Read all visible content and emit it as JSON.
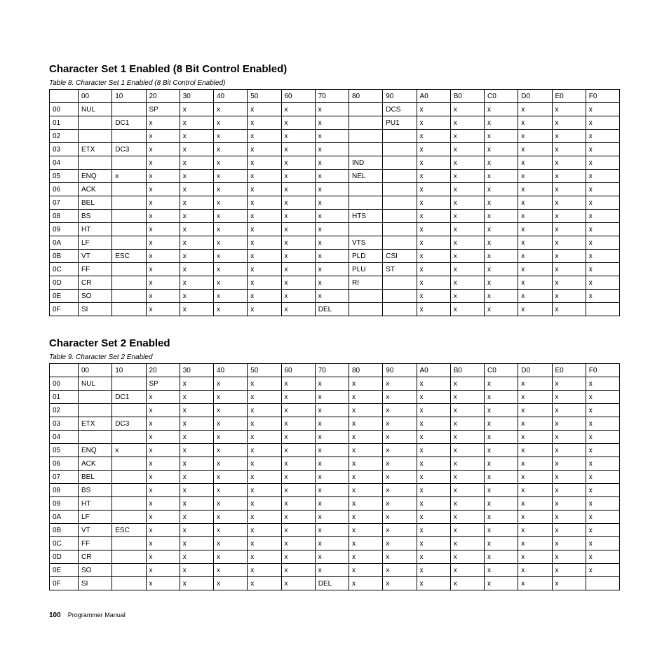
{
  "section1": {
    "heading": "Character Set 1 Enabled (8 Bit Control Enabled)",
    "caption": "Table 8. Character Set 1 Enabled (8 Bit Control Enabled)"
  },
  "section2": {
    "heading": "Character Set 2 Enabled",
    "caption": "Table 9. Character Set 2 Enabled"
  },
  "colHeaders": [
    "00",
    "10",
    "20",
    "30",
    "40",
    "50",
    "60",
    "70",
    "80",
    "90",
    "A0",
    "B0",
    "C0",
    "D0",
    "E0",
    "F0"
  ],
  "rowHeaders": [
    "00",
    "01",
    "02",
    "03",
    "04",
    "05",
    "06",
    "07",
    "08",
    "09",
    "0A",
    "0B",
    "0C",
    "0D",
    "0E",
    "0F"
  ],
  "table1": [
    [
      "NUL",
      "",
      "SP",
      "x",
      "x",
      "x",
      "x",
      "x",
      "",
      "DCS",
      "x",
      "x",
      "x",
      "x",
      "x",
      "x"
    ],
    [
      "",
      "DC1",
      "x",
      "x",
      "x",
      "x",
      "x",
      "x",
      "",
      "PU1",
      "x",
      "x",
      "x",
      "x",
      "x",
      "x"
    ],
    [
      "",
      "",
      "x",
      "x",
      "x",
      "x",
      "x",
      "x",
      "",
      "",
      "x",
      "x",
      "x",
      "x",
      "x",
      "x"
    ],
    [
      "ETX",
      "DC3",
      "x",
      "x",
      "x",
      "x",
      "x",
      "x",
      "",
      "",
      "x",
      "x",
      "x",
      "x",
      "x",
      "x"
    ],
    [
      "",
      "",
      "x",
      "x",
      "x",
      "x",
      "x",
      "x",
      "IND",
      "",
      "x",
      "x",
      "x",
      "x",
      "x",
      "x"
    ],
    [
      "ENQ",
      "x",
      "x",
      "x",
      "x",
      "x",
      "x",
      "x",
      "NEL",
      "",
      "x",
      "x",
      "x",
      "x",
      "x",
      "x"
    ],
    [
      "ACK",
      "",
      "x",
      "x",
      "x",
      "x",
      "x",
      "x",
      "",
      "",
      "x",
      "x",
      "x",
      "x",
      "x",
      "x"
    ],
    [
      "BEL",
      "",
      "x",
      "x",
      "x",
      "x",
      "x",
      "x",
      "",
      "",
      "x",
      "x",
      "x",
      "x",
      "x",
      "x"
    ],
    [
      "BS",
      "",
      "x",
      "x",
      "x",
      "x",
      "x",
      "x",
      "HTS",
      "",
      "x",
      "x",
      "x",
      "x",
      "x",
      "x"
    ],
    [
      "HT",
      "",
      "x",
      "x",
      "x",
      "x",
      "x",
      "x",
      "",
      "",
      "x",
      "x",
      "x",
      "x",
      "x",
      "x"
    ],
    [
      "LF",
      "",
      "x",
      "x",
      "x",
      "x",
      "x",
      "x",
      "VTS",
      "",
      "x",
      "x",
      "x",
      "x",
      "x",
      "x"
    ],
    [
      "VT",
      "ESC",
      "x",
      "x",
      "x",
      "x",
      "x",
      "x",
      "PLD",
      "CSI",
      "x",
      "x",
      "x",
      "x",
      "x",
      "x"
    ],
    [
      "FF",
      "",
      "x",
      "x",
      "x",
      "x",
      "x",
      "x",
      "PLU",
      "ST",
      "x",
      "x",
      "x",
      "x",
      "x",
      "x"
    ],
    [
      "CR",
      "",
      "x",
      "x",
      "x",
      "x",
      "x",
      "x",
      "RI",
      "",
      "x",
      "x",
      "x",
      "x",
      "x",
      "x"
    ],
    [
      "SO",
      "",
      "x",
      "x",
      "x",
      "x",
      "x",
      "x",
      "",
      "",
      "x",
      "x",
      "x",
      "x",
      "x",
      "x"
    ],
    [
      "SI",
      "",
      "x",
      "x",
      "x",
      "x",
      "x",
      "DEL",
      "",
      "",
      "x",
      "x",
      "x",
      "x",
      "x",
      ""
    ]
  ],
  "table2": [
    [
      "NUL",
      "",
      "SP",
      "x",
      "x",
      "x",
      "x",
      "x",
      "x",
      "x",
      "x",
      "x",
      "x",
      "x",
      "x",
      "x"
    ],
    [
      "",
      "DC1",
      "x",
      "x",
      "x",
      "x",
      "x",
      "x",
      "x",
      "x",
      "x",
      "x",
      "x",
      "x",
      "x",
      "x"
    ],
    [
      "",
      "",
      "x",
      "x",
      "x",
      "x",
      "x",
      "x",
      "x",
      "x",
      "x",
      "x",
      "x",
      "x",
      "x",
      "x"
    ],
    [
      "ETX",
      "DC3",
      "x",
      "x",
      "x",
      "x",
      "x",
      "x",
      "x",
      "x",
      "x",
      "x",
      "x",
      "x",
      "x",
      "x"
    ],
    [
      "",
      "",
      "x",
      "x",
      "x",
      "x",
      "x",
      "x",
      "x",
      "x",
      "x",
      "x",
      "x",
      "x",
      "x",
      "x"
    ],
    [
      "ENQ",
      "x",
      "x",
      "x",
      "x",
      "x",
      "x",
      "x",
      "x",
      "x",
      "x",
      "x",
      "x",
      "x",
      "x",
      "x"
    ],
    [
      "ACK",
      "",
      "x",
      "x",
      "x",
      "x",
      "x",
      "x",
      "x",
      "x",
      "x",
      "x",
      "x",
      "x",
      "x",
      "x"
    ],
    [
      "BEL",
      "",
      "x",
      "x",
      "x",
      "x",
      "x",
      "x",
      "x",
      "x",
      "x",
      "x",
      "x",
      "x",
      "x",
      "x"
    ],
    [
      "BS",
      "",
      "x",
      "x",
      "x",
      "x",
      "x",
      "x",
      "x",
      "x",
      "x",
      "x",
      "x",
      "x",
      "x",
      "x"
    ],
    [
      "HT",
      "",
      "x",
      "x",
      "x",
      "x",
      "x",
      "x",
      "x",
      "x",
      "x",
      "x",
      "x",
      "x",
      "x",
      "x"
    ],
    [
      "LF",
      "",
      "x",
      "x",
      "x",
      "x",
      "x",
      "x",
      "x",
      "x",
      "x",
      "x",
      "x",
      "x",
      "x",
      "x"
    ],
    [
      "VT",
      "ESC",
      "x",
      "x",
      "x",
      "x",
      "x",
      "x",
      "x",
      "x",
      "x",
      "x",
      "x",
      "x",
      "x",
      "x"
    ],
    [
      "FF",
      "",
      "x",
      "x",
      "x",
      "x",
      "x",
      "x",
      "x",
      "x",
      "x",
      "x",
      "x",
      "x",
      "x",
      "x"
    ],
    [
      "CR",
      "",
      "x",
      "x",
      "x",
      "x",
      "x",
      "x",
      "x",
      "x",
      "x",
      "x",
      "x",
      "x",
      "x",
      "x"
    ],
    [
      "SO",
      "",
      "x",
      "x",
      "x",
      "x",
      "x",
      "x",
      "x",
      "x",
      "x",
      "x",
      "x",
      "x",
      "x",
      "x"
    ],
    [
      "SI",
      "",
      "x",
      "x",
      "x",
      "x",
      "x",
      "DEL",
      "x",
      "x",
      "x",
      "x",
      "x",
      "x",
      "x",
      ""
    ]
  ],
  "footer": {
    "pageNumber": "100",
    "book": "Programmer Manual"
  }
}
